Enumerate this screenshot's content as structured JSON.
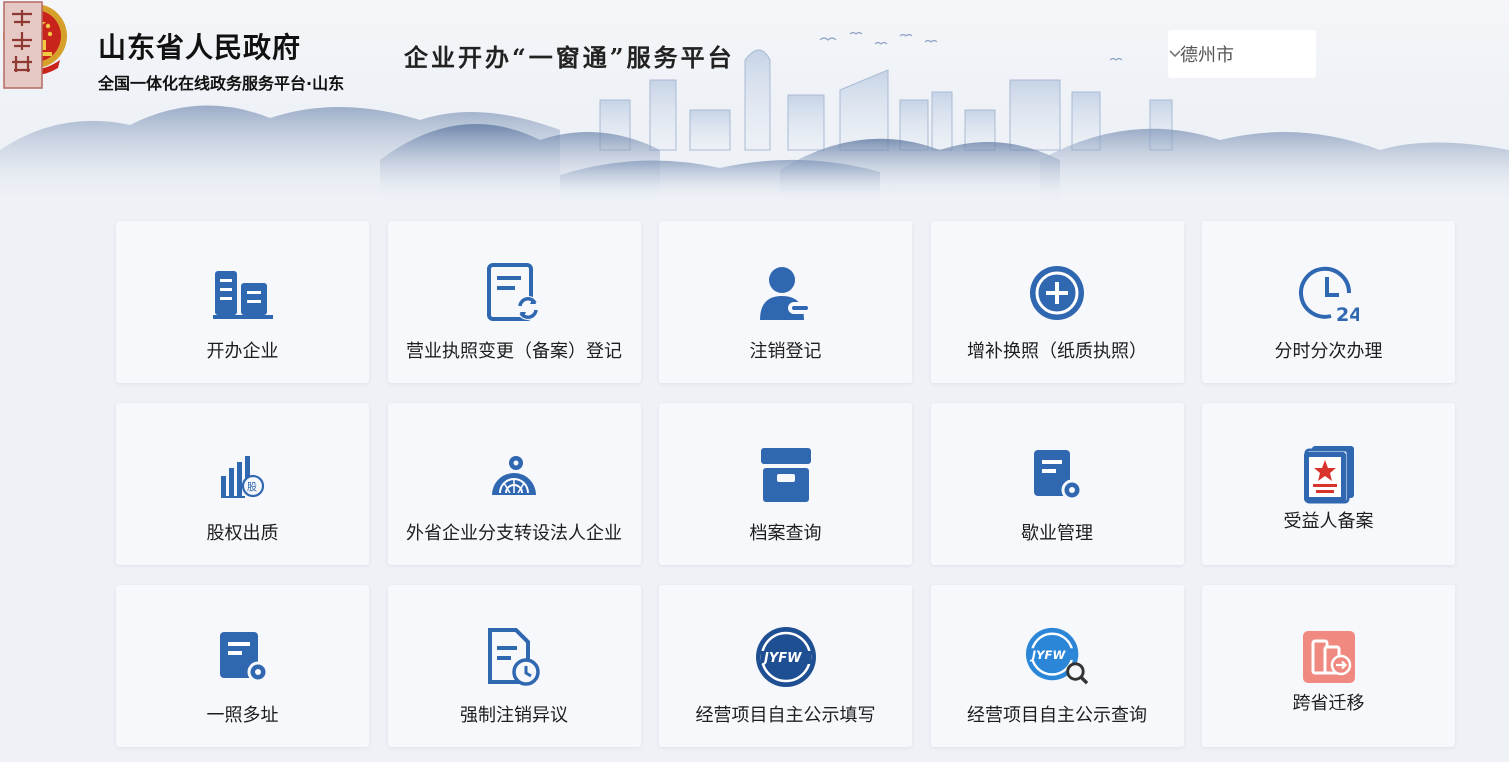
{
  "header": {
    "gov_title": "山东省人民政府",
    "gov_subtitle": "全国一体化在线政务服务平台·山东",
    "platform_title": "企业开办“一窗通”服务平台",
    "city_select": {
      "value": "德州市"
    }
  },
  "colors": {
    "primary": "#2f67b1",
    "accent_red": "#d9342b",
    "salmon": "#f08a80",
    "tile_bg": "#f6f8fb",
    "page_bg": "#eef1f6"
  },
  "services": [
    {
      "label": "开办企业",
      "icon": "buildings-icon"
    },
    {
      "label": "营业执照变更（备案）登记",
      "icon": "license-refresh-icon"
    },
    {
      "label": "注销登记",
      "icon": "user-minus-icon"
    },
    {
      "label": "增补换照（纸质执照）",
      "icon": "plus-circle-icon"
    },
    {
      "label": "分时分次办理",
      "icon": "clock-24-icon"
    },
    {
      "label": "股权出质",
      "icon": "stock-chart-icon"
    },
    {
      "label": "外省企业分支转设法人企业",
      "icon": "gear-arch-icon"
    },
    {
      "label": "档案查询",
      "icon": "archive-box-icon"
    },
    {
      "label": "歇业管理",
      "icon": "doc-gear-icon"
    },
    {
      "label": "受益人备案",
      "icon": "star-cards-icon"
    },
    {
      "label": "一照多址",
      "icon": "doc-gear-small-icon"
    },
    {
      "label": "强制注销异议",
      "icon": "doc-clock-icon"
    },
    {
      "label": "经营项目自主公示填写",
      "icon": "jyfw-badge-icon"
    },
    {
      "label": "经营项目自主公示查询",
      "icon": "jyfw-search-icon"
    },
    {
      "label": "跨省迁移",
      "icon": "transfer-icon"
    }
  ]
}
